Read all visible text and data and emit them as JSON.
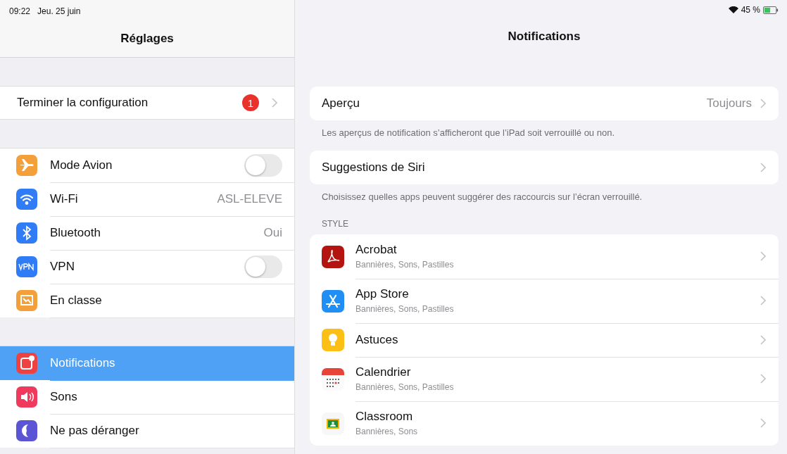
{
  "status_bar": {
    "time": "09:22",
    "date": "Jeu. 25 juin",
    "battery": "45 %"
  },
  "sidebar": {
    "title": "Réglages",
    "setup": {
      "label": "Terminer la configuration",
      "badge": "1"
    },
    "groups": [
      [
        {
          "label": "Mode Avion",
          "kind": "toggle",
          "on": false,
          "selected": false
        },
        {
          "label": "Wi-Fi",
          "kind": "value",
          "value": "ASL-ELEVE",
          "selected": false
        },
        {
          "label": "Bluetooth",
          "kind": "value",
          "value": "Oui",
          "selected": false
        },
        {
          "label": "VPN",
          "kind": "toggle",
          "on": false,
          "selected": false
        },
        {
          "label": "En classe",
          "kind": "plain",
          "selected": false
        }
      ],
      [
        {
          "label": "Notifications",
          "kind": "plain",
          "selected": true
        },
        {
          "label": "Sons",
          "kind": "plain",
          "selected": false
        },
        {
          "label": "Ne pas déranger",
          "kind": "plain",
          "selected": false
        }
      ]
    ]
  },
  "detail": {
    "title": "Notifications",
    "preview": {
      "label": "Aperçu",
      "value": "Toujours",
      "footer": "Les aperçus de notification s’afficheront que l’iPad soit verrouillé ou non."
    },
    "siri": {
      "label": "Suggestions de Siri",
      "footer": "Choisissez quelles apps peuvent suggérer des raccourcis sur l’écran verrouillé."
    },
    "section": "STYLE",
    "apps": [
      {
        "name": "Acrobat",
        "subtitle": "Bannières, Sons, Pastilles"
      },
      {
        "name": "App Store",
        "subtitle": "Bannières, Sons, Pastilles"
      },
      {
        "name": "Astuces"
      },
      {
        "name": "Calendrier",
        "subtitle": "Bannières, Sons, Pastilles"
      },
      {
        "name": "Classroom",
        "subtitle": "Bannières, Sons"
      }
    ]
  }
}
